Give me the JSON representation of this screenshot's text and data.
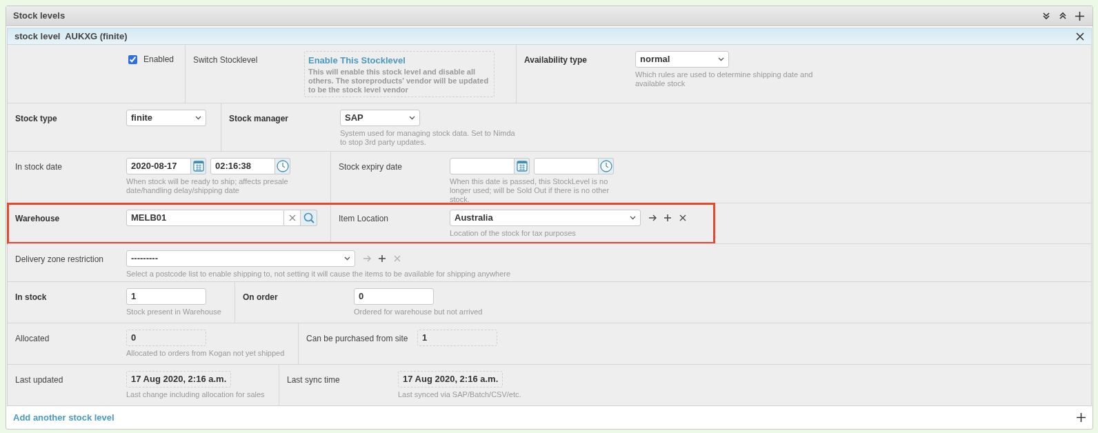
{
  "panel": {
    "title": "Stock levels"
  },
  "stock_level": {
    "title": "stock level  AUKXG (finite)"
  },
  "rows": [
    {
      "cells": [
        {
          "control": {
            "kind": "checkbox",
            "checked": true,
            "text": "Enabled"
          }
        },
        {
          "label": "Switch Stocklevel",
          "control": {
            "kind": "action_box",
            "title": "Enable This Stocklevel",
            "text": "This will enable this stock level and disable all others. The storeproducts' vendor will be updated to be the stock level vendor"
          }
        },
        {
          "label": "Availability type",
          "bold": true,
          "control": {
            "kind": "select",
            "value": "normal",
            "help": "Which rules are used to determine shipping date and available stock"
          }
        }
      ]
    },
    {
      "cells": [
        {
          "label": "Stock type",
          "bold": true,
          "control": {
            "kind": "select",
            "value": "finite"
          }
        },
        {
          "label": "Stock manager",
          "bold": true,
          "control": {
            "kind": "select",
            "value": "SAP",
            "help": "System used for managing stock data. Set to Nimda to stop 3rd party updates."
          }
        }
      ]
    },
    {
      "cells": [
        {
          "label": "In stock date",
          "control": {
            "kind": "datetime",
            "date": "2020-08-17",
            "time": "02:16:38",
            "help": "When stock will be ready to ship; affects presale date/handling delay/shipping date"
          }
        },
        {
          "label": "Stock expiry date",
          "control": {
            "kind": "datetime",
            "help": "When this date is passed, this StockLevel is no longer used; will be Sold Out if there is no other stock."
          }
        }
      ]
    },
    {
      "highlighted": true,
      "cells": [
        {
          "label": "Warehouse",
          "bold": true,
          "control": {
            "kind": "lookup",
            "value": "MELB01"
          }
        },
        {
          "label": "Item Location",
          "control": {
            "kind": "select_actions",
            "value": "Australia",
            "help": "Location of the stock for tax purposes",
            "actions": [
              {
                "kind": "arrow",
                "disabled": false
              },
              {
                "kind": "plus",
                "disabled": false
              },
              {
                "kind": "cross",
                "disabled": false
              }
            ]
          }
        }
      ]
    },
    {
      "cells": [
        {
          "label": "Delivery zone restriction",
          "control": {
            "kind": "select_actions",
            "value": "---------",
            "help": "Select a postcode list to enable shipping to, not setting it will cause the items to be available for shipping anywhere",
            "actions": [
              {
                "kind": "arrow",
                "disabled": true
              },
              {
                "kind": "plus",
                "disabled": false
              },
              {
                "kind": "cross",
                "disabled": true
              }
            ]
          }
        }
      ]
    },
    {
      "cells": [
        {
          "label": "In stock",
          "bold": true,
          "control": {
            "kind": "text",
            "value": "1",
            "help": "Stock present in Warehouse"
          }
        },
        {
          "label": "On order",
          "bold": true,
          "control": {
            "kind": "text",
            "value": "0",
            "help": "Ordered for warehouse but not arrived"
          }
        }
      ]
    },
    {
      "cells": [
        {
          "label": "Allocated",
          "control": {
            "kind": "readonly",
            "value": "0",
            "help": "Allocated to orders from Kogan not yet shipped"
          }
        },
        {
          "label": "Can be purchased from site",
          "control": {
            "kind": "readonly",
            "value": "1"
          }
        }
      ]
    },
    {
      "cells": [
        {
          "label": "Last updated",
          "control": {
            "kind": "readonly",
            "value": "17 Aug 2020, 2:16 a.m.",
            "help": "Last change including allocation for sales"
          }
        },
        {
          "label": "Last sync time",
          "control": {
            "kind": "readonly",
            "value": "17 Aug 2020, 2:16 a.m.",
            "help": "Last synced via SAP/Batch/CSV/etc."
          }
        }
      ]
    }
  ],
  "footer": {
    "link": "Add another stock level"
  }
}
